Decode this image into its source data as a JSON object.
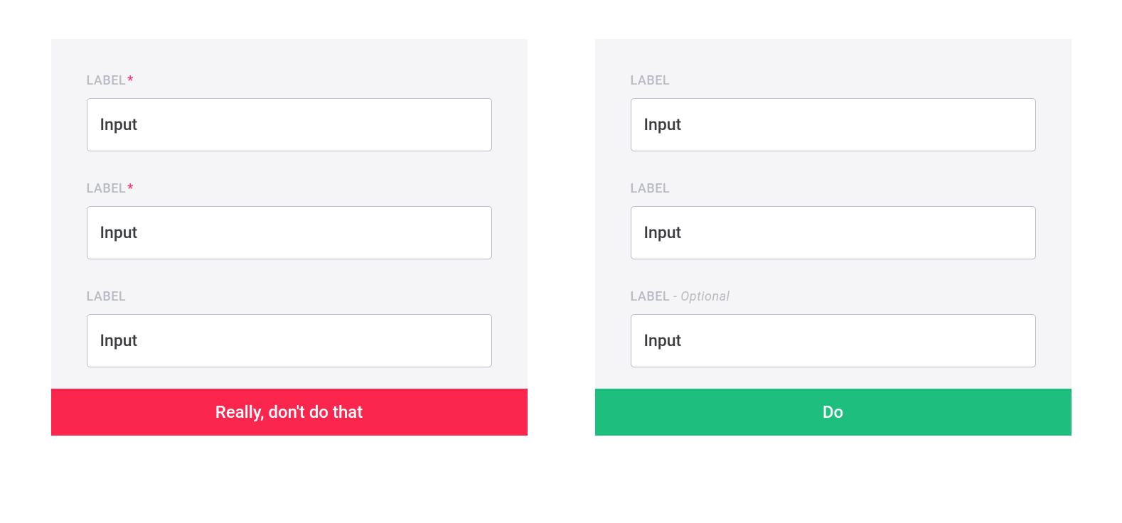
{
  "dont_card": {
    "fields": [
      {
        "label": "LABEL",
        "required_marker": "*",
        "value": "Input"
      },
      {
        "label": "LABEL",
        "required_marker": "*",
        "value": "Input"
      },
      {
        "label": "LABEL",
        "required_marker": "",
        "value": "Input"
      }
    ],
    "footer": "Really, don't do that"
  },
  "do_card": {
    "fields": [
      {
        "label": "LABEL",
        "suffix": "",
        "value": "Input"
      },
      {
        "label": "LABEL",
        "suffix": "",
        "value": "Input"
      },
      {
        "label": "LABEL",
        "suffix": " - Optional",
        "value": "Input"
      }
    ],
    "footer": "Do"
  },
  "colors": {
    "dont_bg": "#FA264D",
    "do_bg": "#1DBE7E",
    "label_text": "#B8BCC2",
    "input_border": "#B7BBC5",
    "card_bg": "#F5F5F7"
  }
}
